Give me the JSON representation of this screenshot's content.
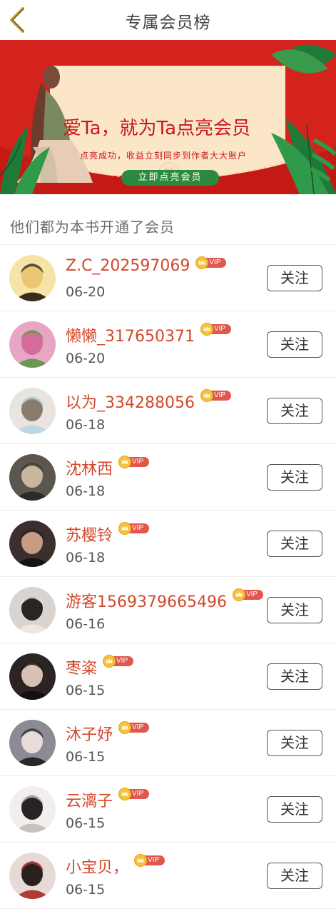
{
  "header": {
    "title": "专属会员榜",
    "back_icon": "chevron-left-icon"
  },
  "banner": {
    "title": "爱Ta，就为Ta点亮会员",
    "subtitle": "点亮成功，收益立刻同步到作者大大账户",
    "cta_label": "立即点亮会员",
    "colors": {
      "background": "#d4221c",
      "card": "#fbe7c7",
      "accent_red": "#c8161e",
      "cta_green": "#2c8a3c"
    }
  },
  "section_title": "他们都为本书开通了会员",
  "vip_badge": {
    "label": "VIP",
    "icon": "crown-icon",
    "color": "#e0574d"
  },
  "follow_label": "关注",
  "members": [
    {
      "name": "Z.C_202597069",
      "date": "06-20"
    },
    {
      "name": "懒懒_317650371",
      "date": "06-20"
    },
    {
      "name": "以为_334288056",
      "date": "06-18"
    },
    {
      "name": "沈林西",
      "date": "06-18"
    },
    {
      "name": "苏樱铃",
      "date": "06-18"
    },
    {
      "name": "游客1569379665496",
      "date": "06-16"
    },
    {
      "name": "枣粢",
      "date": "06-15"
    },
    {
      "name": "沐子妤",
      "date": "06-15"
    },
    {
      "name": "云漓子",
      "date": "06-15"
    },
    {
      "name": "小宝贝，",
      "date": "06-15"
    }
  ]
}
